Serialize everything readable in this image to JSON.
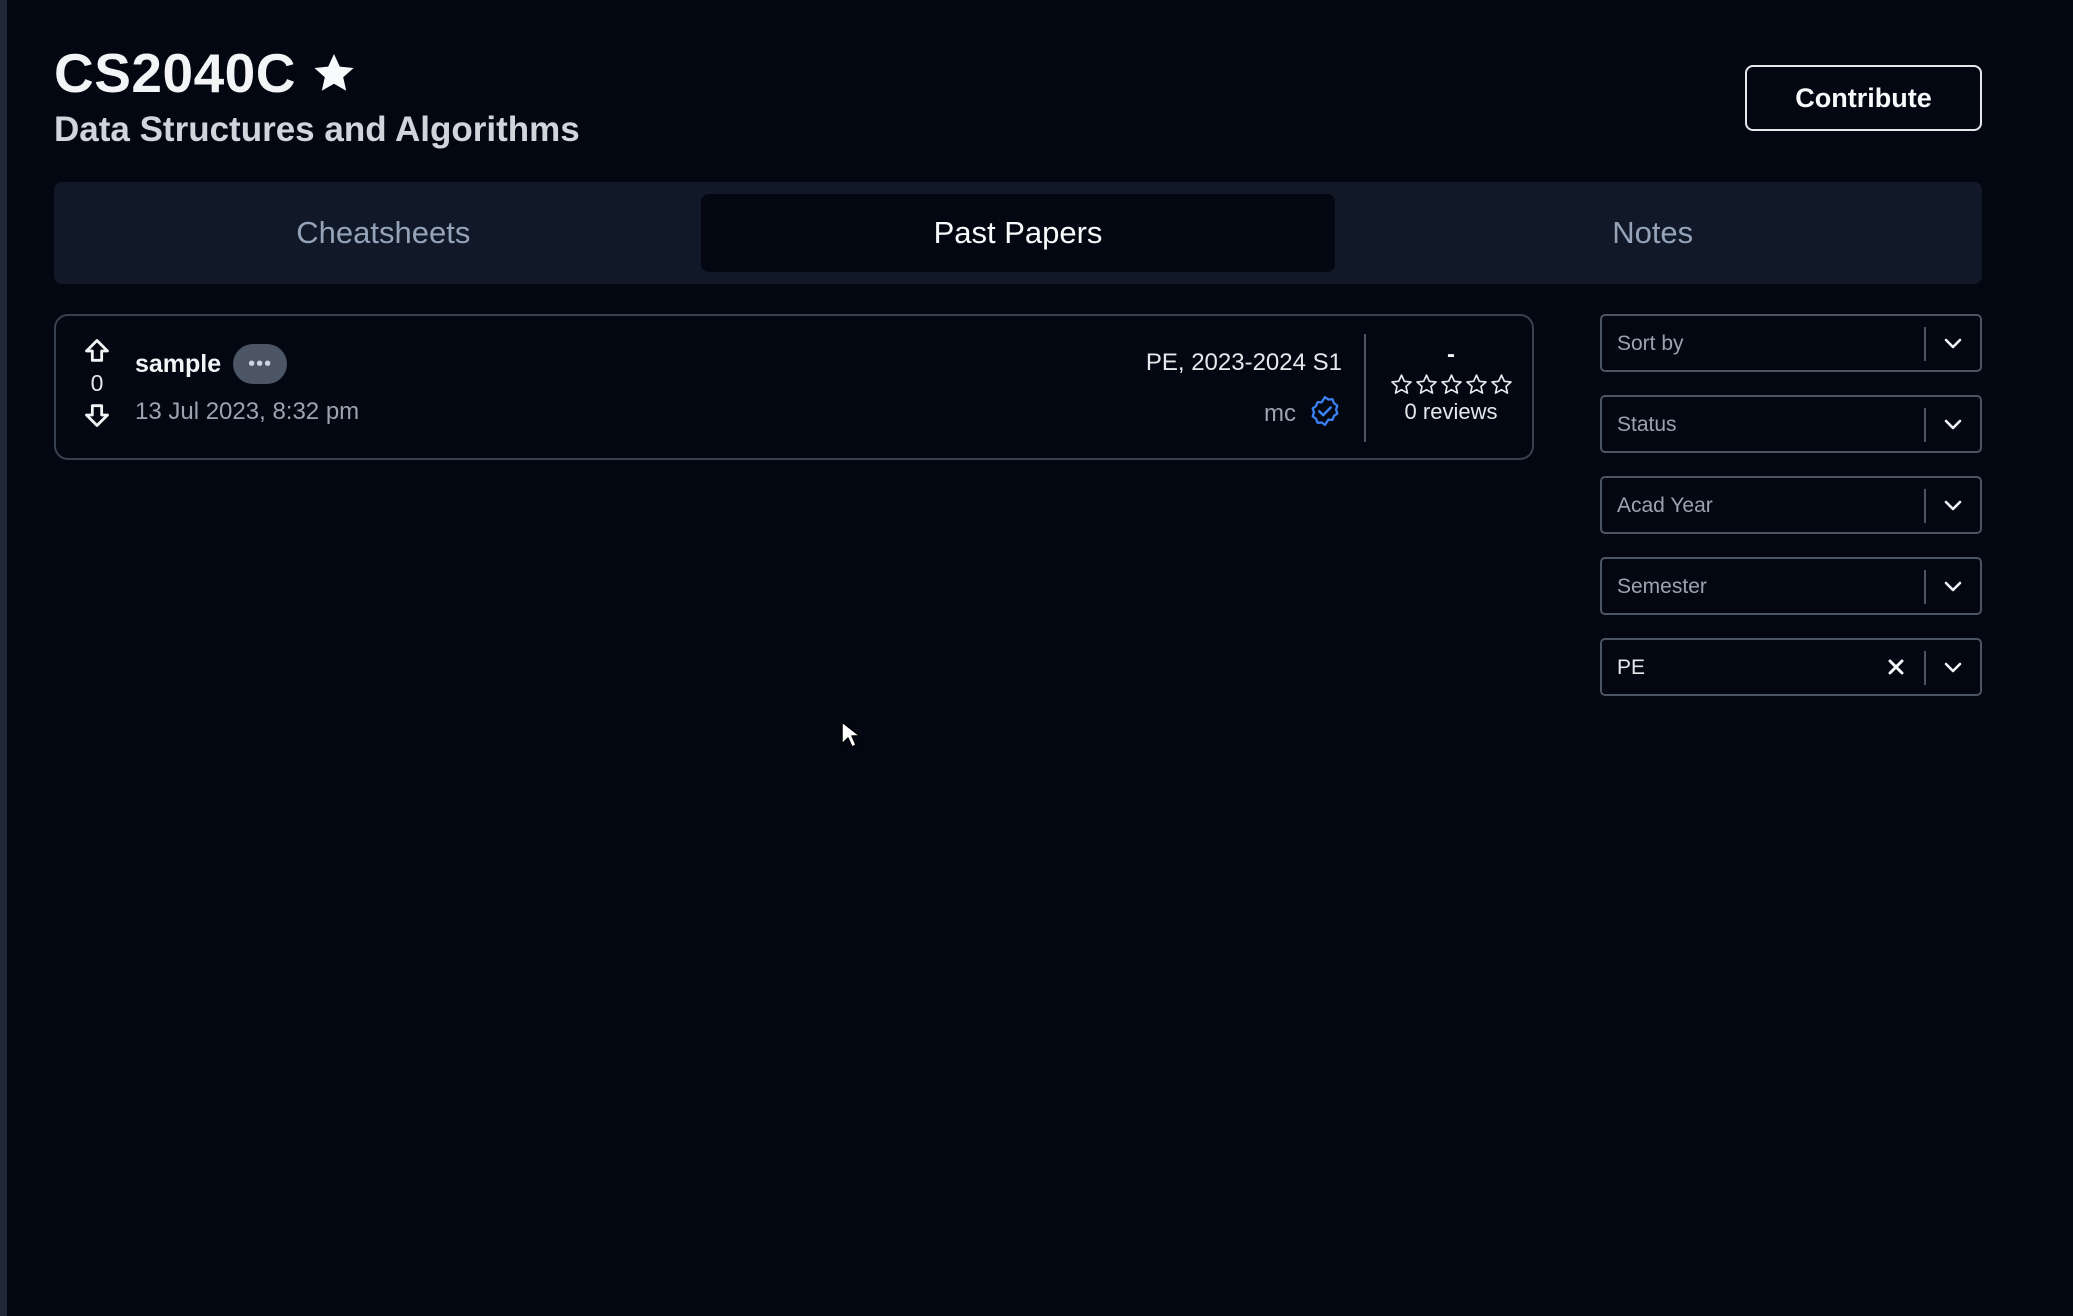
{
  "course": {
    "code": "CS2040C",
    "name": "Data Structures and Algorithms",
    "favorite_icon": "star-icon"
  },
  "header": {
    "contribute_label": "Contribute"
  },
  "tabs": [
    {
      "label": "Cheatsheets",
      "active": false
    },
    {
      "label": "Past Papers",
      "active": true
    },
    {
      "label": "Notes",
      "active": false
    }
  ],
  "papers": [
    {
      "title": "sample",
      "votes": "0",
      "date": "13 Jul 2023, 8:32 pm",
      "type": "PE, 2023-2024 S1",
      "uploader": "mc",
      "uploader_verified": true,
      "rating": "-",
      "stars_filled": 0,
      "stars_total": 5,
      "reviews": "0 reviews"
    }
  ],
  "filters": [
    {
      "placeholder": "Sort by",
      "value": ""
    },
    {
      "placeholder": "Status",
      "value": ""
    },
    {
      "placeholder": "Acad Year",
      "value": ""
    },
    {
      "placeholder": "Semester",
      "value": ""
    },
    {
      "placeholder": "",
      "value": "PE"
    }
  ],
  "colors": {
    "background": "#030712",
    "tab_bar": "#111827",
    "verified_accent": "#3b82f6"
  }
}
